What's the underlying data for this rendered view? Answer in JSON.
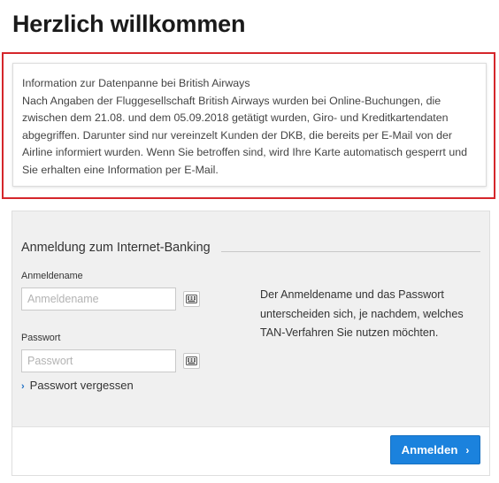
{
  "page": {
    "title": "Herzlich willkommen"
  },
  "notice": {
    "heading": "Information zur Datenpanne bei British Airways",
    "body": "Nach Angaben der Fluggesellschaft British Airways wurden bei Online-Buchungen, die zwischen dem 21.08. und dem 05.09.2018 getätigt wurden, Giro- und Kreditkartendaten abgegriffen. Darunter sind nur vereinzelt Kunden der DKB, die bereits per E-Mail von der Airline informiert wurden. Wenn Sie betroffen sind, wird Ihre Karte automatisch gesperrt und Sie erhalten eine Information per E-Mail.",
    "highlight_color": "#d5262b"
  },
  "login": {
    "heading": "Anmeldung zum Internet-Banking",
    "username": {
      "label": "Anmeldename",
      "placeholder": "Anmeldename",
      "value": ""
    },
    "password": {
      "label": "Passwort",
      "placeholder": "Passwort",
      "value": ""
    },
    "keyboard_icon": "virtual-keyboard-icon",
    "forgot_password": "Passwort vergessen",
    "help_text": "Der Anmeldename und das Passwort unterscheiden sich, je nachdem, welches TAN-Verfahren Sie nutzen möchten.",
    "submit_label": "Anmelden",
    "accent_color": "#1b82dd"
  }
}
